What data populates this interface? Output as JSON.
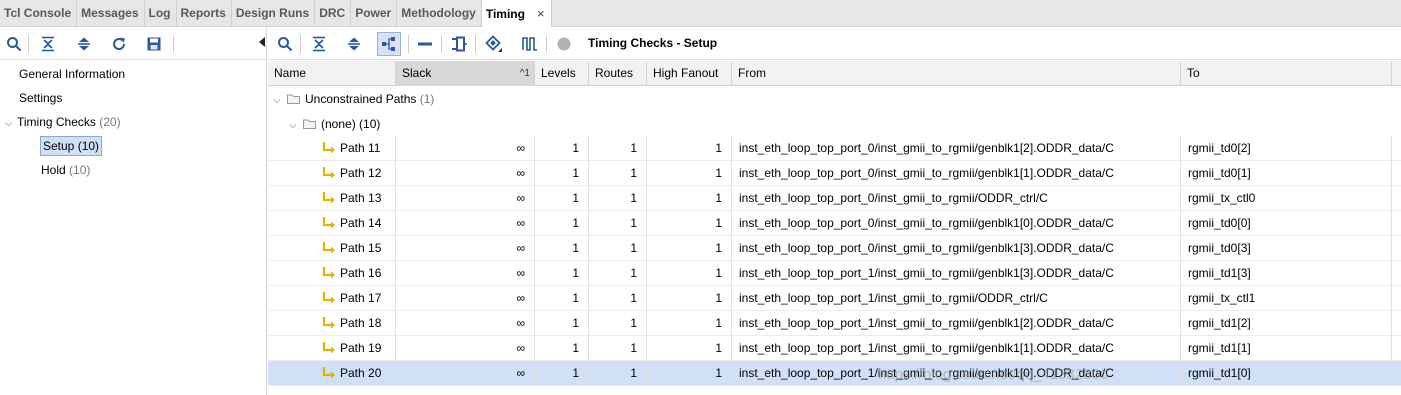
{
  "tabs": [
    {
      "label": "Tcl Console"
    },
    {
      "label": "Messages"
    },
    {
      "label": "Log"
    },
    {
      "label": "Reports"
    },
    {
      "label": "Design Runs"
    },
    {
      "label": "DRC"
    },
    {
      "label": "Power"
    },
    {
      "label": "Methodology"
    },
    {
      "label": "Timing",
      "active": true
    }
  ],
  "tab_close_glyph": "×",
  "left_toolbar_icons": [
    "search-icon",
    "collapse-all-icon",
    "expand-all-icon",
    "refresh-icon",
    "save-icon"
  ],
  "tree": {
    "general": "General Information",
    "settings": "Settings",
    "timing_checks": {
      "label": "Timing Checks",
      "count": "(20)"
    },
    "setup": {
      "label": "Setup (10)"
    },
    "hold": {
      "label": "Hold",
      "count": "(10)"
    }
  },
  "right_toolbar": {
    "title": "Timing Checks - Setup",
    "icons": [
      "search-icon",
      "collapse-all-icon",
      "expand-all-icon",
      "hierarchy-icon",
      "minus-icon",
      "schematic-icon",
      "highlight-icon",
      "waveform-icon",
      "status-circle-icon"
    ]
  },
  "table": {
    "columns": [
      "Name",
      "Slack",
      "Levels",
      "Routes",
      "High Fanout",
      "From",
      "To"
    ],
    "sort_mark": "^1",
    "group": {
      "label": "Unconstrained Paths",
      "count": "(1)"
    },
    "subgroup": {
      "label": "(none) (10)"
    },
    "rows": [
      {
        "name": "Path 11",
        "slack": "∞",
        "levels": "1",
        "routes": "1",
        "fanout": "1",
        "from": "inst_eth_loop_top_port_0/inst_gmii_to_rgmii/genblk1[2].ODDR_data/C",
        "to": "rgmii_td0[2]"
      },
      {
        "name": "Path 12",
        "slack": "∞",
        "levels": "1",
        "routes": "1",
        "fanout": "1",
        "from": "inst_eth_loop_top_port_0/inst_gmii_to_rgmii/genblk1[1].ODDR_data/C",
        "to": "rgmii_td0[1]"
      },
      {
        "name": "Path 13",
        "slack": "∞",
        "levels": "1",
        "routes": "1",
        "fanout": "1",
        "from": "inst_eth_loop_top_port_0/inst_gmii_to_rgmii/ODDR_ctrl/C",
        "to": "rgmii_tx_ctl0"
      },
      {
        "name": "Path 14",
        "slack": "∞",
        "levels": "1",
        "routes": "1",
        "fanout": "1",
        "from": "inst_eth_loop_top_port_0/inst_gmii_to_rgmii/genblk1[0].ODDR_data/C",
        "to": "rgmii_td0[0]"
      },
      {
        "name": "Path 15",
        "slack": "∞",
        "levels": "1",
        "routes": "1",
        "fanout": "1",
        "from": "inst_eth_loop_top_port_0/inst_gmii_to_rgmii/genblk1[3].ODDR_data/C",
        "to": "rgmii_td0[3]"
      },
      {
        "name": "Path 16",
        "slack": "∞",
        "levels": "1",
        "routes": "1",
        "fanout": "1",
        "from": "inst_eth_loop_top_port_1/inst_gmii_to_rgmii/genblk1[3].ODDR_data/C",
        "to": "rgmii_td1[3]"
      },
      {
        "name": "Path 17",
        "slack": "∞",
        "levels": "1",
        "routes": "1",
        "fanout": "1",
        "from": "inst_eth_loop_top_port_1/inst_gmii_to_rgmii/ODDR_ctrl/C",
        "to": "rgmii_tx_ctl1"
      },
      {
        "name": "Path 18",
        "slack": "∞",
        "levels": "1",
        "routes": "1",
        "fanout": "1",
        "from": "inst_eth_loop_top_port_1/inst_gmii_to_rgmii/genblk1[2].ODDR_data/C",
        "to": "rgmii_td1[2]"
      },
      {
        "name": "Path 19",
        "slack": "∞",
        "levels": "1",
        "routes": "1",
        "fanout": "1",
        "from": "inst_eth_loop_top_port_1/inst_gmii_to_rgmii/genblk1[1].ODDR_data/C",
        "to": "rgmii_td1[1]"
      },
      {
        "name": "Path 20",
        "slack": "∞",
        "levels": "1",
        "routes": "1",
        "fanout": "1",
        "from": "inst_eth_loop_top_port_1/inst_gmii_to_rgmii/genblk1[0].ODDR_data/C",
        "to": "rgmii_td1[0]",
        "selected": true
      }
    ]
  },
  "watermark": "https://blog.csdn.net/qq_41332806",
  "colors": {
    "selection": "#cfe0f7",
    "path_icon": "#e0b400",
    "tool_icon": "#2a5a9a"
  }
}
